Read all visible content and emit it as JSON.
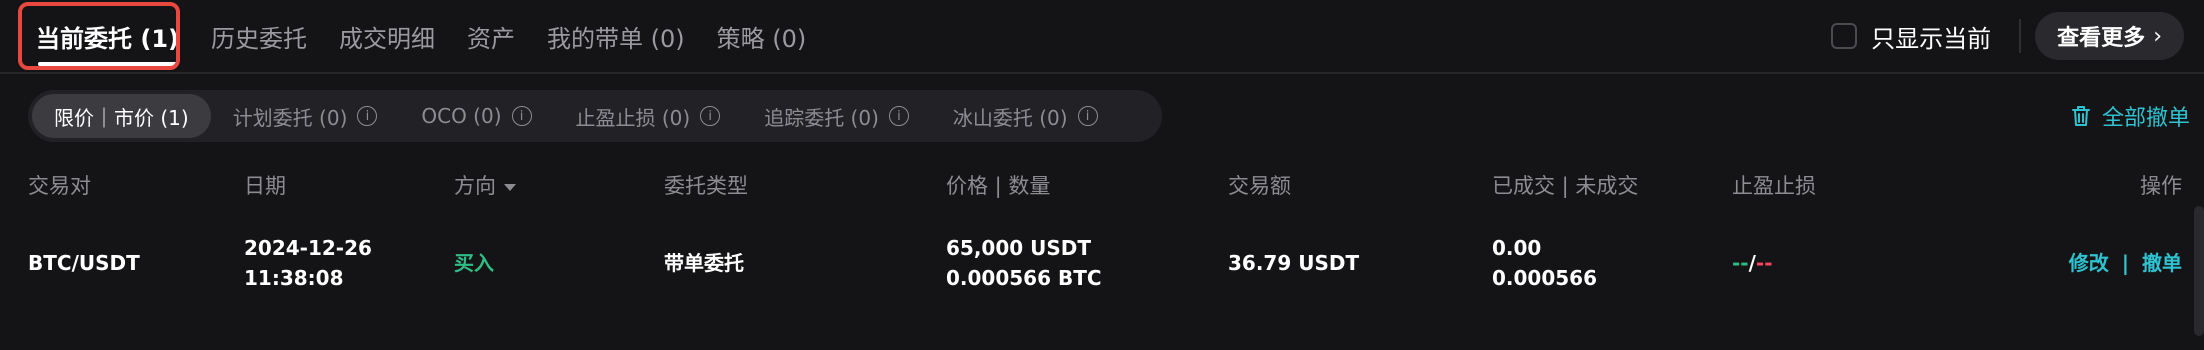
{
  "top_tabs": [
    {
      "label": "当前委托 (1)",
      "active": true
    },
    {
      "label": "历史委托",
      "active": false
    },
    {
      "label": "成交明细",
      "active": false
    },
    {
      "label": "资产",
      "active": false
    },
    {
      "label": "我的带单 (0)",
      "active": false
    },
    {
      "label": "策略 (0)",
      "active": false
    }
  ],
  "top_right": {
    "only_current_label": "只显示当前",
    "view_more_label": "查看更多",
    "view_more_chevron": "›"
  },
  "sub_tabs": [
    {
      "label": "限价｜市价 (1)",
      "active": true
    },
    {
      "label": "计划委托 (0)"
    },
    {
      "label": "OCO (0)"
    },
    {
      "label": "止盈止损 (0)"
    },
    {
      "label": "追踪委托 (0)"
    },
    {
      "label": "冰山委托 (0)"
    }
  ],
  "info_glyph": "i",
  "cancel_all_label": "全部撤单",
  "table": {
    "headers": {
      "pair": "交易对",
      "date": "日期",
      "side": "方向",
      "type": "委托类型",
      "price_qty": "价格 | 数量",
      "amount": "交易额",
      "filled": "已成交 | 未成交",
      "tpsl": "止盈止损",
      "actions": "操作"
    },
    "rows": [
      {
        "pair": "BTC/USDT",
        "date": "2024-12-26",
        "time": "11:38:08",
        "side": "买入",
        "type": "带单委托",
        "price": "65,000 USDT",
        "qty": "0.000566 BTC",
        "amount": "36.79 USDT",
        "filled": "0.00",
        "unfilled": "0.000566",
        "tp": "--",
        "sep": "/",
        "sl": "--",
        "edit": "修改",
        "action_sep": "|",
        "cancel": "撤单"
      }
    ]
  },
  "colors": {
    "background": "#141416",
    "accent": "#2fc2d0",
    "buy": "#2ebd85",
    "sell": "#f6465d",
    "highlight": "#e8483f"
  }
}
